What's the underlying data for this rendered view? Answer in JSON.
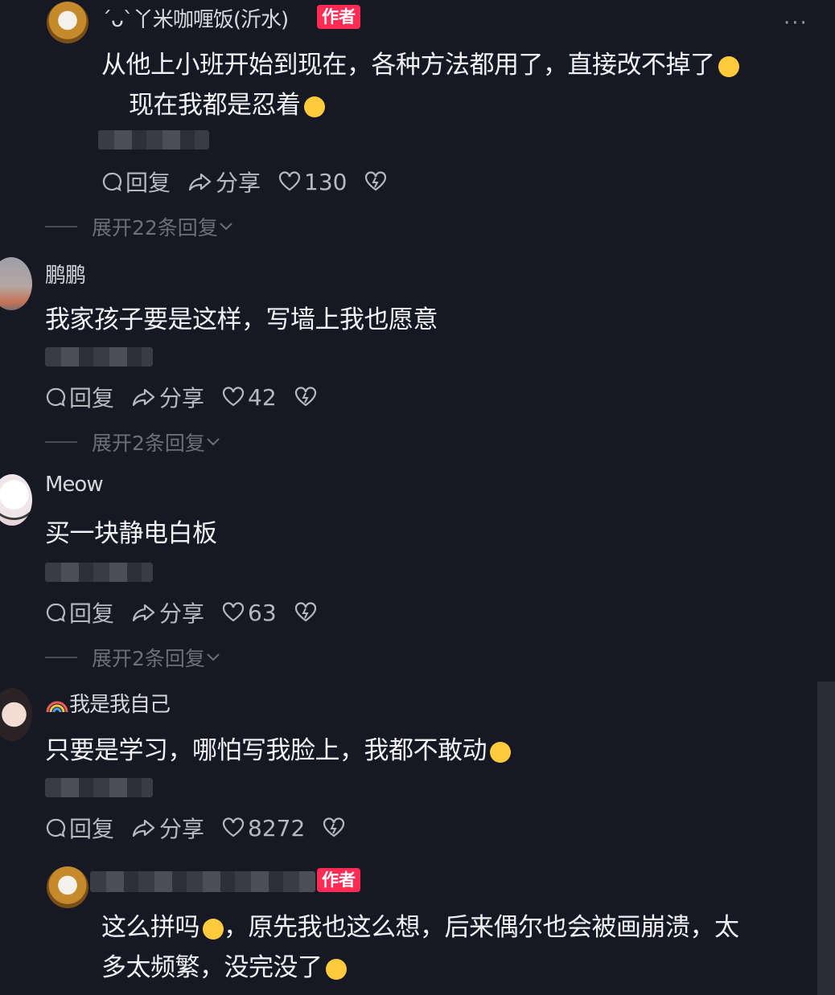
{
  "colors": {
    "background": "#161823",
    "author_badge": "#fe2c55",
    "meta": "#b8b8bf"
  },
  "actions": {
    "reply_label": "回复",
    "share_label": "分享"
  },
  "comments": [
    {
      "username": "ˊᴗˋ丫米咖喱饭(沂水)",
      "badge": "作者",
      "line1": "从他上小班开始到现在，各种方法都用了，直接改不掉了",
      "line2": "现在我都是忍着",
      "likes": "130",
      "expand": "展开22条回复"
    },
    {
      "username": "鹏鹏",
      "line1": "我家孩子要是这样，写墙上我也愿意",
      "likes": "42",
      "expand": "展开2条回复"
    },
    {
      "username": "Meow",
      "line1": "买一块静电白板",
      "likes": "63",
      "expand": "展开2条回复"
    },
    {
      "username": "我是我自己",
      "line1": "只要是学习，哪怕写我脸上，我都不敢动",
      "likes": "8272"
    },
    {
      "badge": "作者",
      "line1": "这么拼吗",
      "line1b": "，原先我也这么想，后来偶尔也会被画崩溃，太",
      "line2": "多太频繁，没完没了"
    }
  ],
  "icons": [
    "more-icon",
    "reply-icon",
    "share-icon",
    "heart-icon",
    "dislike-icon",
    "chevron-down-icon",
    "emoji-icon",
    "rainbow-icon"
  ]
}
